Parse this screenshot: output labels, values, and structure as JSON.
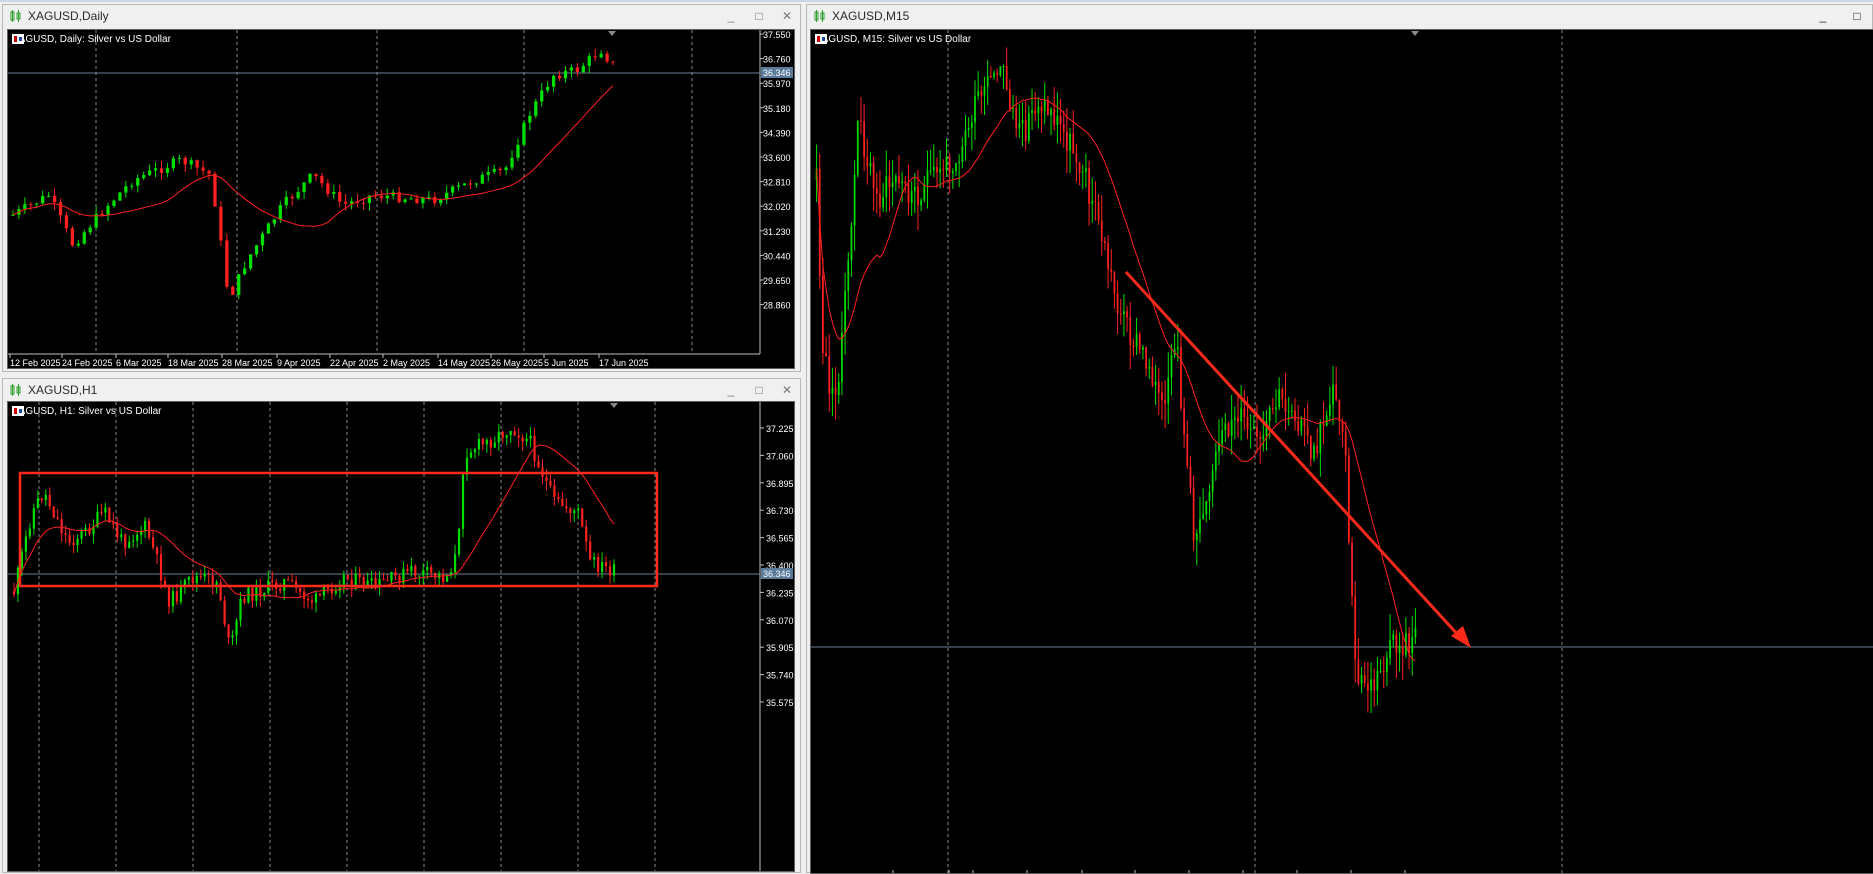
{
  "windows": {
    "daily": {
      "title": "XAGUSD,Daily",
      "chart_label": "XAGUSD, Daily:  Silver vs US Dollar",
      "price_labels": [
        "37.550",
        "36.760",
        "35.970",
        "35.180",
        "34.390",
        "33.600",
        "32.810",
        "32.020",
        "31.230",
        "30.440",
        "29.650",
        "28.860"
      ],
      "current_price": "36.346",
      "date_labels": [
        "12 Feb 2025",
        "24 Feb 2025",
        "6 Mar 2025",
        "18 Mar 2025",
        "28 Mar 2025",
        "9 Apr 2025",
        "22 Apr 2025",
        "2 May 2025",
        "14 May 2025",
        "26 May 2025",
        "5 Jun 2025",
        "17 Jun 2025"
      ]
    },
    "h1": {
      "title": "XAGUSD,H1",
      "chart_label": "XAGUSD, H1:  Silver vs US Dollar",
      "price_labels": [
        "37.225",
        "37.060",
        "36.895",
        "36.730",
        "36.565",
        "36.400",
        "36.235",
        "36.070",
        "35.905",
        "35.740",
        "35.575"
      ],
      "current_price": "36.346"
    },
    "m15": {
      "title": "XAGUSD,M15",
      "chart_label": "XAGUSD, M15:  Silver vs US Dollar"
    }
  },
  "controls": {
    "minimize": "_",
    "maximize": "□",
    "close": "✕"
  },
  "colors": {
    "bull": "#00e000",
    "bear": "#ff2020",
    "ma": "#ff2020",
    "grid": "#8a8a8a",
    "annotation": "#ff2a1a",
    "price_tag_bg": "#5a7a9a"
  }
}
